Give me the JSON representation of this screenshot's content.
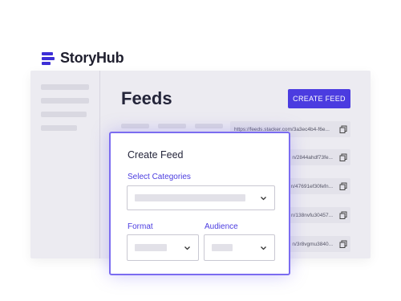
{
  "brand": {
    "name": "StoryHub",
    "icon": "storyhub-logo-icon",
    "color": "#3d2fd6"
  },
  "page": {
    "title": "Feeds"
  },
  "toolbar": {
    "create_label": "CREATE FEED"
  },
  "feeds": [
    {
      "url": "https://feeds.stacker.com/3a3ec4b4-f6e..."
    },
    {
      "url": "n/2844ahdf73fe..."
    },
    {
      "url": "n/47691ef30fefn..."
    },
    {
      "url": "n/138nvfu30457..."
    },
    {
      "url": "n/3r8vgmu3840..."
    }
  ],
  "modal": {
    "title": "Create Feed",
    "categories_label": "Select Categories",
    "format_label": "Format",
    "audience_label": "Audience"
  },
  "colors": {
    "accent": "#4b3ce0",
    "modal_border": "#7b6cf0"
  }
}
